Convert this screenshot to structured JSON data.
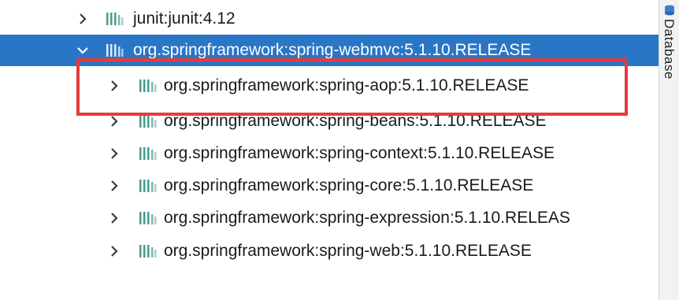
{
  "tree": {
    "rows": [
      {
        "label": "junit:junit:4.12",
        "expanded": false,
        "selected": false
      },
      {
        "label": "org.springframework:spring-webmvc:5.1.10.RELEASE",
        "expanded": true,
        "selected": true
      },
      {
        "label": "org.springframework:spring-aop:5.1.10.RELEASE",
        "expanded": false,
        "selected": false
      },
      {
        "label": "org.springframework:spring-beans:5.1.10.RELEASE",
        "expanded": false,
        "selected": false
      },
      {
        "label": "org.springframework:spring-context:5.1.10.RELEASE",
        "expanded": false,
        "selected": false
      },
      {
        "label": "org.springframework:spring-core:5.1.10.RELEASE",
        "expanded": false,
        "selected": false
      },
      {
        "label": "org.springframework:spring-expression:5.1.10.RELEAS",
        "expanded": false,
        "selected": false
      },
      {
        "label": "org.springframework:spring-web:5.1.10.RELEASE",
        "expanded": false,
        "selected": false
      }
    ]
  },
  "side_panel": {
    "tab_label": "Database",
    "icon": "database-icon"
  },
  "colors": {
    "selection": "#2a76c6",
    "highlight_border": "#e83a3a",
    "library_icon": "#4a9a8e"
  }
}
